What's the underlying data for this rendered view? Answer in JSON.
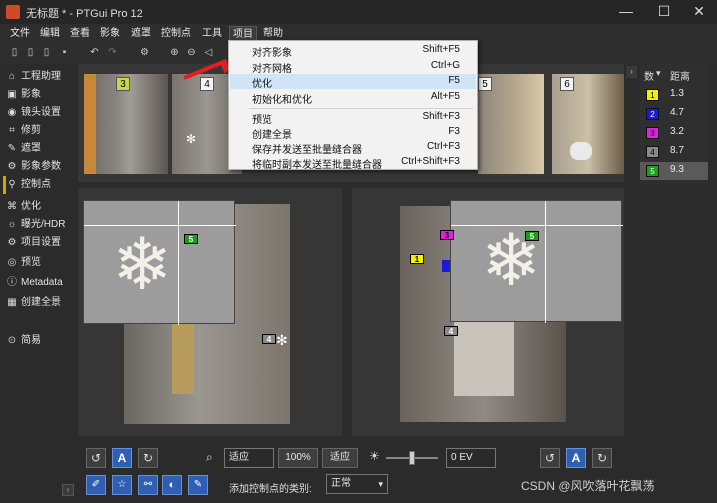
{
  "window": {
    "title": "无标题 * - PTGui Pro 12",
    "minimize": "—",
    "maximize": "☐",
    "close": "✕"
  },
  "menubar": [
    "文件",
    "编辑",
    "查看",
    "影象",
    "遮罩",
    "控制点",
    "工具",
    "项目",
    "帮助"
  ],
  "sidebar": {
    "items": [
      {
        "icon": "⌂",
        "label": "工程助理"
      },
      {
        "icon": "▣",
        "label": "影象"
      },
      {
        "icon": "◉",
        "label": "镜头设置"
      },
      {
        "icon": "⌗",
        "label": "修剪"
      },
      {
        "icon": "✎",
        "label": "遮罩"
      },
      {
        "icon": "⚙",
        "label": "影象参数"
      },
      {
        "icon": "⚲",
        "label": "控制点"
      },
      {
        "icon": "⌘",
        "label": "优化"
      },
      {
        "icon": "☼",
        "label": "曝光/HDR"
      },
      {
        "icon": "⚙",
        "label": "项目设置"
      },
      {
        "icon": "◎",
        "label": "预览"
      },
      {
        "icon": "ⓘ",
        "label": "Metadata"
      },
      {
        "icon": "▦",
        "label": "创建全景"
      }
    ],
    "simple": {
      "icon": "⊙",
      "label": "简易"
    }
  },
  "thumbs": [
    "3",
    "4",
    "5",
    "6"
  ],
  "right_table": {
    "header_num": "数",
    "header_sort": "▾",
    "header_dist": "距离",
    "rows": [
      {
        "id": "1",
        "color": "#f5f000",
        "value": "1.3"
      },
      {
        "id": "2",
        "color": "#1a1ad8",
        "value": "4.7"
      },
      {
        "id": "3",
        "color": "#e020e0",
        "value": "3.2"
      },
      {
        "id": "4",
        "color": "#8a8a8a",
        "value": "8.7"
      },
      {
        "id": "5",
        "color": "#18a018",
        "value": "9.3"
      }
    ]
  },
  "dropdown": {
    "items": [
      {
        "label": "对齐影象",
        "shortcut": "Shift+F5"
      },
      {
        "label": "对齐网格",
        "shortcut": "Ctrl+G"
      },
      {
        "label": "优化",
        "shortcut": "F5"
      },
      {
        "label": "初始化和优化",
        "shortcut": "Alt+F5"
      },
      {
        "label": "预览",
        "shortcut": "Shift+F3"
      },
      {
        "label": "创建全景",
        "shortcut": "F3"
      },
      {
        "label": "保存并发送至批量缝合器",
        "shortcut": "Ctrl+F3"
      },
      {
        "label": "将临时副本发送至批量缝合器",
        "shortcut": "Ctrl+Shift+F3"
      }
    ]
  },
  "panels": {
    "left_cps": [
      {
        "id": "5"
      },
      {
        "id": "4"
      }
    ],
    "right_cps": [
      {
        "id": "5"
      },
      {
        "id": "3"
      },
      {
        "id": "1"
      },
      {
        "id": "4"
      }
    ]
  },
  "bottom": {
    "fit_left": "适应",
    "zoom": "100%",
    "fit_right": "适应",
    "ev": "0 EV",
    "cp_type_label": "添加控制点的类别:",
    "cp_type_value": "正常"
  },
  "watermark": "CSDN @风吹落叶花飘荡"
}
